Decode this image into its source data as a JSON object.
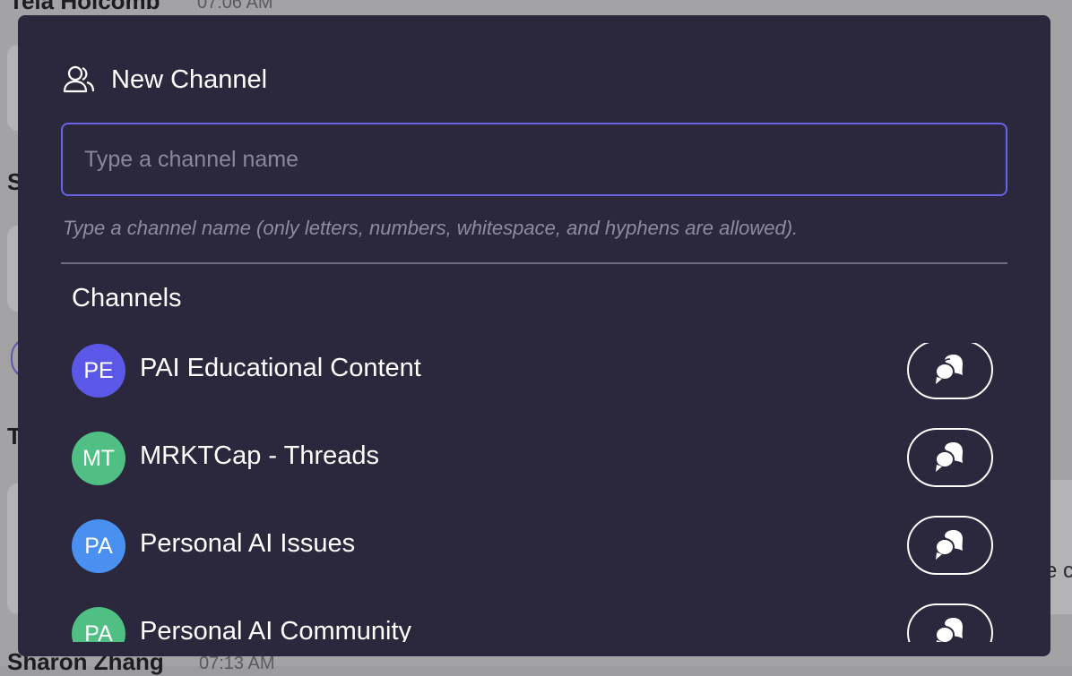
{
  "background": {
    "top_author": "Tela Holcomb",
    "top_time": "07:06 AM",
    "bottom_author": "Sharon Zhang",
    "bottom_time": "07:13 AM",
    "fragment_s": "S",
    "fragment_t": "T",
    "fragment_e": "e c"
  },
  "modal": {
    "title": "New Channel",
    "title_icon": "users-icon",
    "input_value": "",
    "input_placeholder": "Type a channel name",
    "hint": "Type a channel name (only letters, numbers, whitespace, and hyphens are allowed).",
    "section_title": "Channels"
  },
  "channels": [
    {
      "initials": "PE",
      "name": "PAI Educational Content",
      "color": "#5b58e8",
      "action_icon": "chat-bubbles-icon"
    },
    {
      "initials": "MT",
      "name": "MRKTCap - Threads",
      "color": "#4fbf83",
      "action_icon": "chat-bubbles-icon"
    },
    {
      "initials": "PA",
      "name": "Personal AI Issues",
      "color": "#4a90f0",
      "action_icon": "chat-bubbles-icon"
    },
    {
      "initials": "PA",
      "name": "Personal AI Community",
      "color": "#4fbf83",
      "action_icon": "chat-bubbles-icon"
    }
  ],
  "colors": {
    "modal_bg": "#2b283e",
    "accent": "#6b63e6"
  }
}
